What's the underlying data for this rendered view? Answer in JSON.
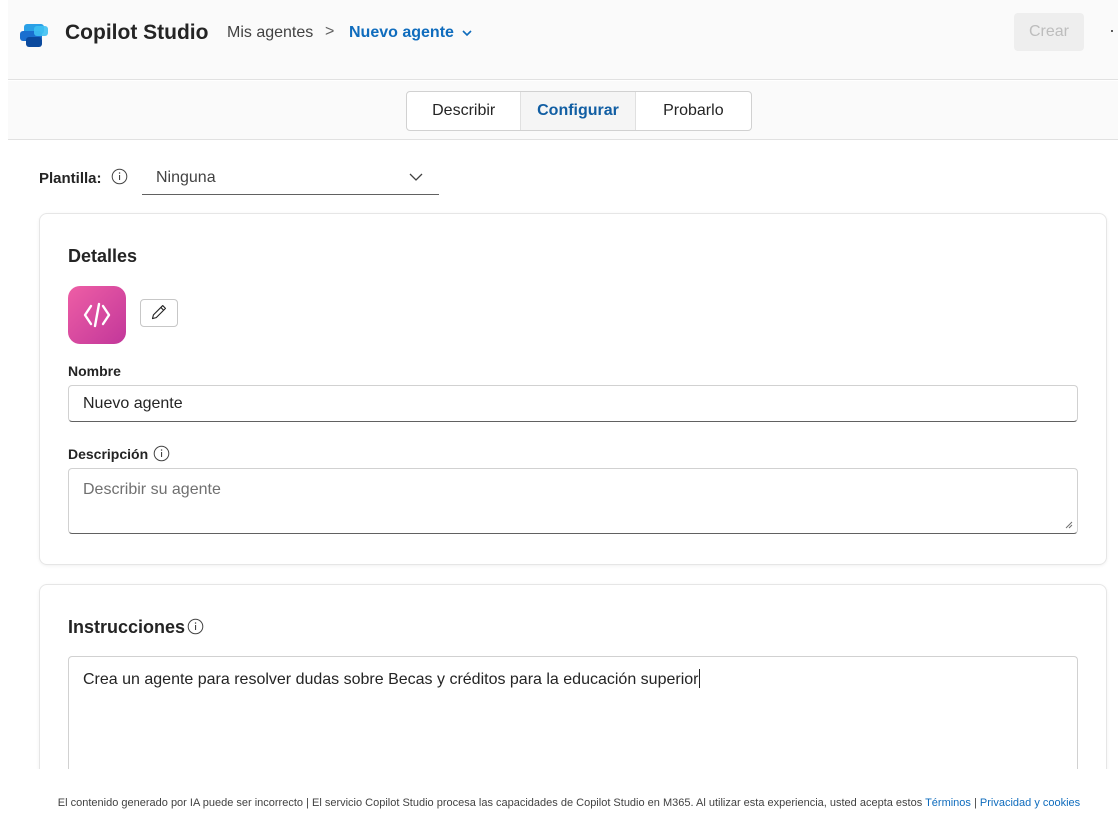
{
  "header": {
    "app_title": "Copilot Studio",
    "breadcrumb_parent": "Mis agentes",
    "breadcrumb_separator": ">",
    "breadcrumb_current": "Nuevo agente",
    "create_button": "Crear",
    "more_button": "···"
  },
  "tabs": [
    {
      "label": "Describir",
      "selected": false
    },
    {
      "label": "Configurar",
      "selected": true
    },
    {
      "label": "Probarlo",
      "selected": false
    }
  ],
  "template": {
    "label": "Plantilla:",
    "value": "Ninguna"
  },
  "details": {
    "title": "Detalles",
    "name_label": "Nombre",
    "name_value": "Nuevo agente",
    "description_label": "Descripción",
    "description_placeholder": "Describir su agente"
  },
  "instructions": {
    "title": "Instrucciones",
    "value": "Crea un agente para resolver dudas sobre Becas y créditos para la educación superior"
  },
  "footer": {
    "text": "El contenido generado por IA puede ser incorrecto | El servicio Copilot Studio procesa las capacidades de Copilot Studio en M365. Al utilizar esta experiencia, usted acepta estos ",
    "terms_link": "Términos",
    "separator": " | ",
    "privacy_link": "Privacidad y cookies"
  },
  "colors": {
    "accent": "#0f6cbd",
    "avatar_gradient_start": "#ee5ea5",
    "avatar_gradient_end": "#c2379a"
  }
}
